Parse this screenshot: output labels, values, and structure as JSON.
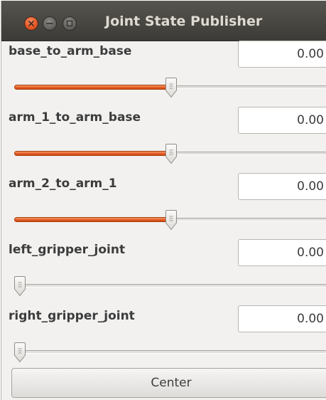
{
  "window": {
    "title": "Joint State Publisher",
    "controls": [
      {
        "name": "close-button",
        "icon": "close-icon",
        "color": "#e2531f"
      },
      {
        "name": "minimize-button",
        "icon": "minimize-icon",
        "color": "#5f5e5a"
      },
      {
        "name": "maximize-button",
        "icon": "maximize-icon",
        "color": "#5f5e5a"
      }
    ]
  },
  "accent_color": "#e65a22",
  "joints": [
    {
      "label": "base_to_arm_base",
      "value": "0.00",
      "slider_level": 0.5
    },
    {
      "label": "arm_1_to_arm_base",
      "value": "0.00",
      "slider_level": 0.5
    },
    {
      "label": "arm_2_to_arm_1",
      "value": "0.00",
      "slider_level": 0.5
    },
    {
      "label": "left_gripper_joint",
      "value": "0.00",
      "slider_level": 0.0
    },
    {
      "label": "right_gripper_joint",
      "value": "0.00",
      "slider_level": 0.0
    }
  ],
  "center_button": {
    "label": "Center"
  }
}
